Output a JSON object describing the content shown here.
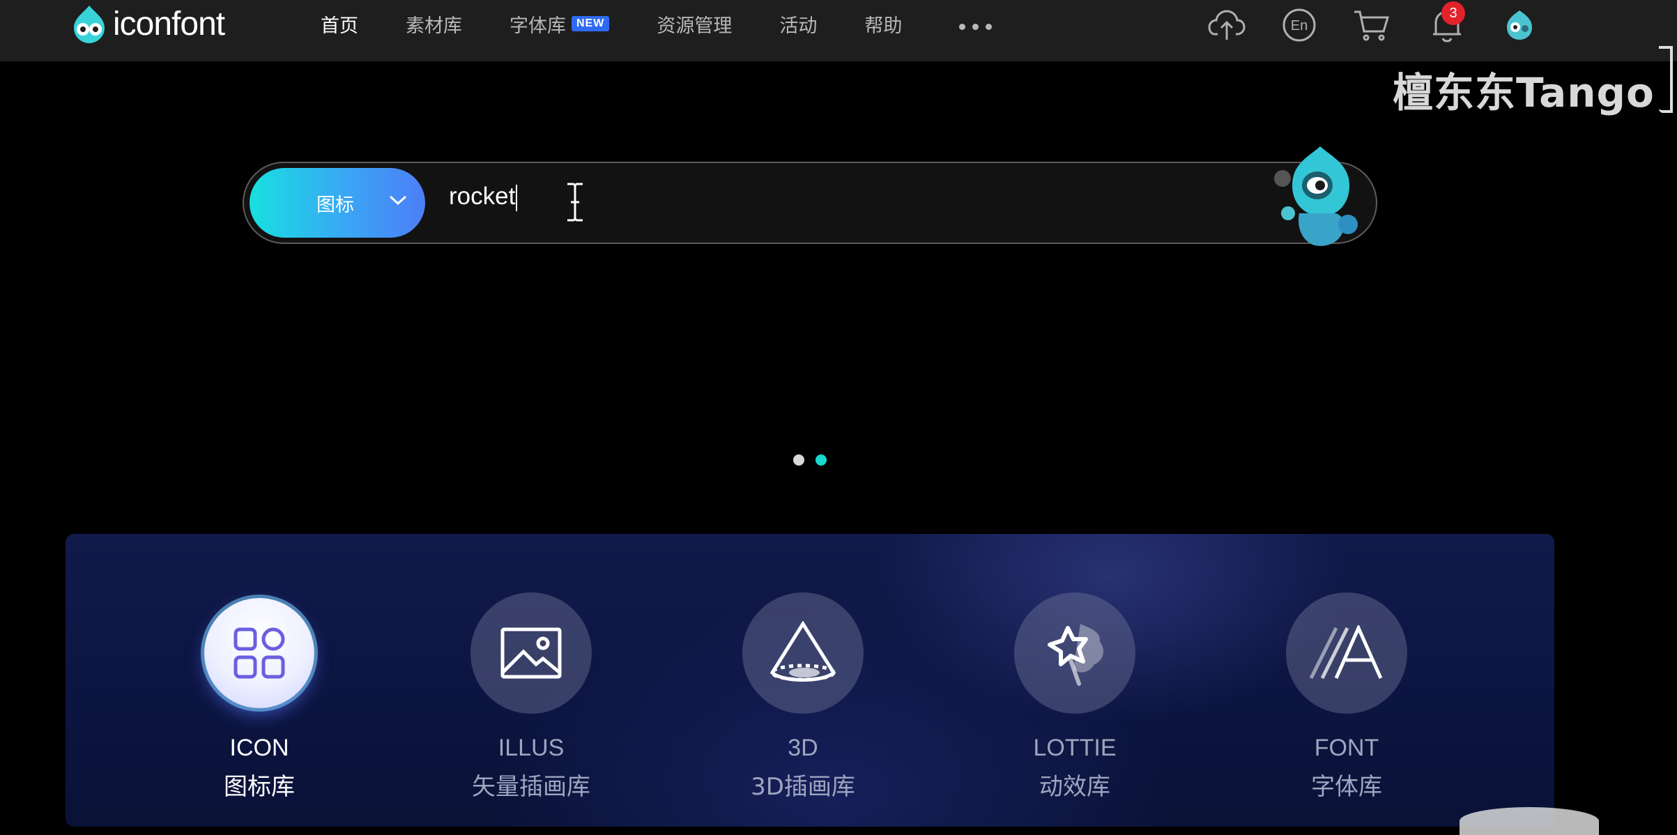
{
  "header": {
    "logo_text": "iconfont",
    "nav": [
      {
        "label": "首页",
        "active": true
      },
      {
        "label": "素材库"
      },
      {
        "label": "字体库",
        "badge": "NEW"
      },
      {
        "label": "资源管理"
      },
      {
        "label": "活动"
      },
      {
        "label": "帮助"
      }
    ],
    "icons": {
      "upload": "cloud-upload-icon",
      "language": "En",
      "cart": "cart-icon",
      "notifications": "bell-icon",
      "avatar": "avatar-icon"
    },
    "notification_count": "3"
  },
  "watermark": "檀东东Tango",
  "search": {
    "type_label": "图标",
    "value": "rocket"
  },
  "carousel": {
    "count": 2,
    "active_index": 1
  },
  "categories": [
    {
      "en": "ICON",
      "zh": "图标库",
      "icon": "grid-icon",
      "active": true
    },
    {
      "en": "ILLUS",
      "zh": "矢量插画库",
      "icon": "image-icon"
    },
    {
      "en": "3D",
      "zh": "3D插画库",
      "icon": "cone-icon"
    },
    {
      "en": "LOTTIE",
      "zh": "动效库",
      "icon": "star-burst-icon"
    },
    {
      "en": "FONT",
      "zh": "字体库",
      "icon": "letter-a-icon"
    }
  ],
  "colors": {
    "accent_cyan": "#19d9d0",
    "accent_blue": "#4d7ef6",
    "badge_red": "#e4222a",
    "panel_navy": "#0c1440"
  }
}
